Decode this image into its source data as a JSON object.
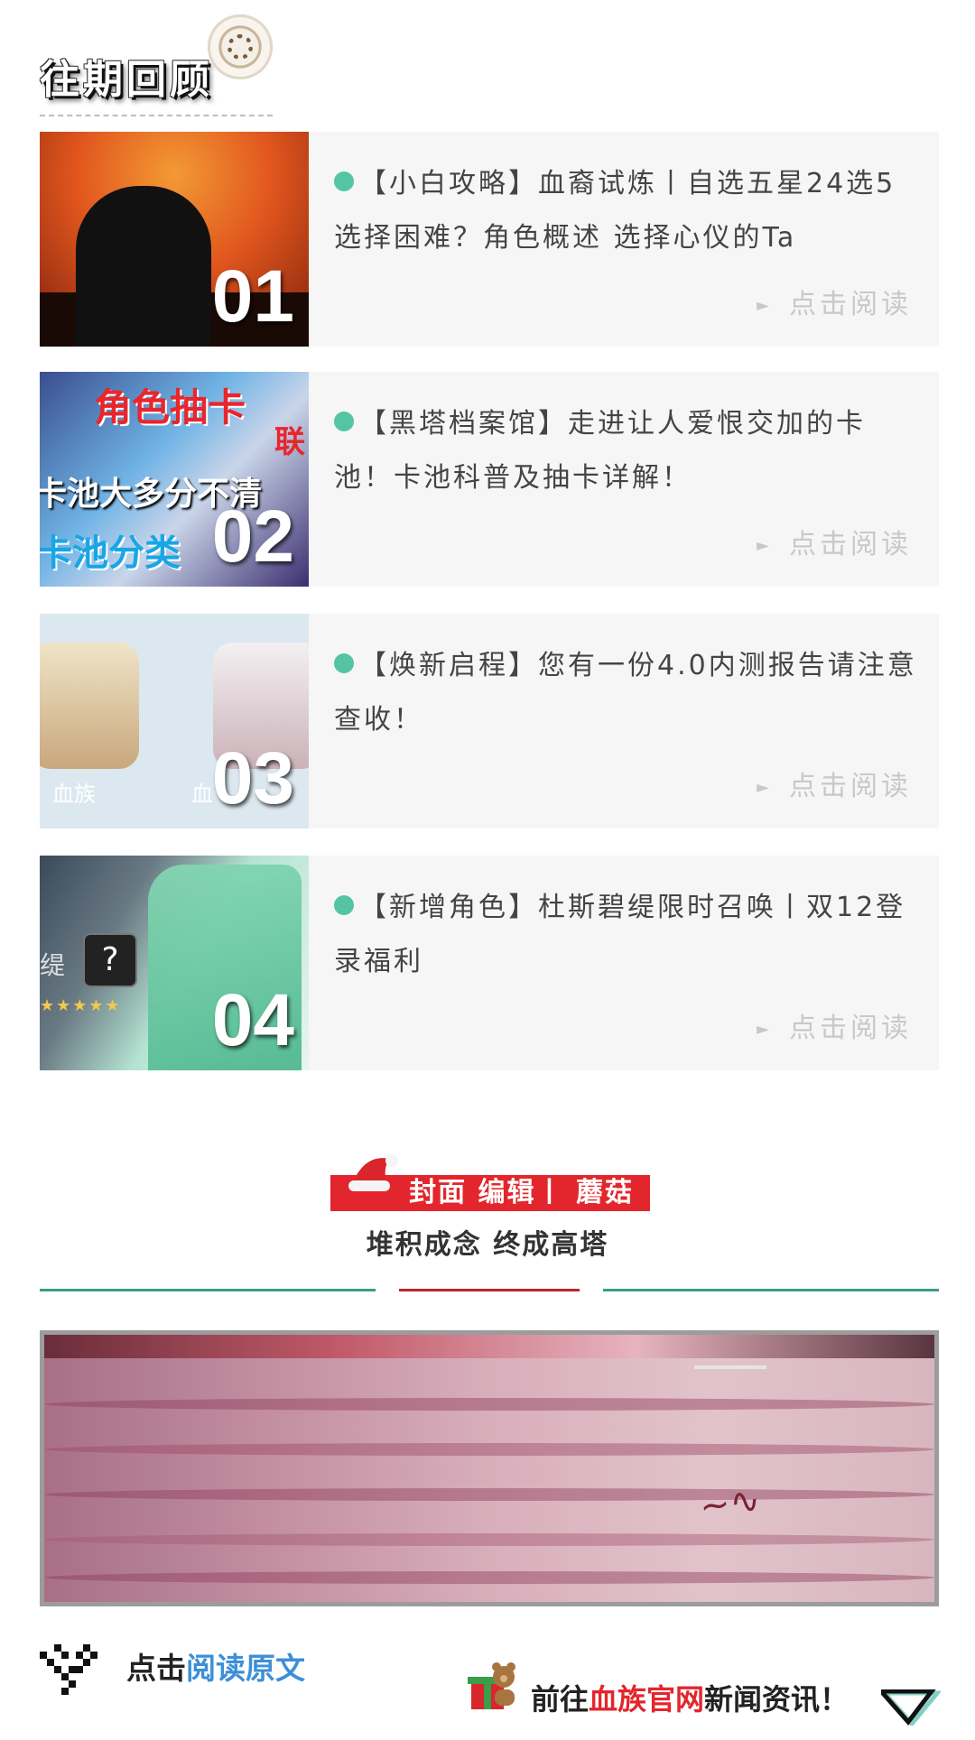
{
  "header": {
    "title": "往期回顾"
  },
  "articles": [
    {
      "num": "01",
      "title": "【小白攻略】血裔试炼丨自选五星24选5 选择困难？角色概述 选择心仪的Ta",
      "read": "点击阅读"
    },
    {
      "num": "02",
      "title": "【黑塔档案馆】走进让人爱恨交加的卡池！卡池科普及抽卡详解！",
      "read": "点击阅读",
      "thumb_text": [
        "角色抽卡",
        "卡池大多分不清",
        "卡池分类",
        "联"
      ]
    },
    {
      "num": "03",
      "title": "【焕新启程】您有一份4.0内测报告请注意查收！",
      "read": "点击阅读",
      "thumb_text": [
        "血族",
        "血"
      ]
    },
    {
      "num": "04",
      "title": "【新增角色】杜斯碧缇限时召唤丨双12登录福利",
      "read": "点击阅读",
      "thumb_text": [
        "缇",
        "?",
        "★★★★★"
      ]
    }
  ],
  "editor": {
    "label": "封面 编辑丨 蘑菇",
    "subtitle": "堆积成念 终成高塔"
  },
  "footer": {
    "read_prefix": "点击",
    "read_link": "阅读原文",
    "news_prefix": "前往",
    "news_highlight": "血族官网",
    "news_suffix": "新闻资讯！"
  },
  "colors": {
    "accent_green": "#55c4a0",
    "accent_red": "#e3262d",
    "rule_teal": "#3b9a89",
    "link_blue": "#3c8fd8"
  }
}
